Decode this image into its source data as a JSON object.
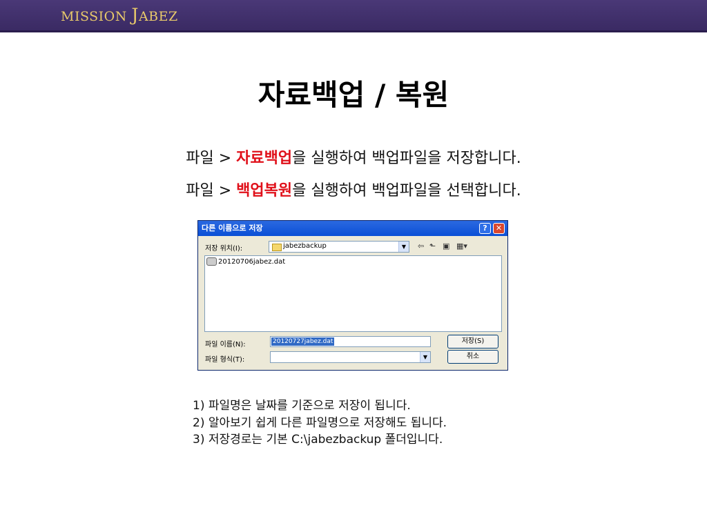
{
  "header": {
    "brand_small": "MISSION ",
    "brand_big": "J",
    "brand_rest": "ABEZ"
  },
  "title": "자료백업 / 복원",
  "instructions": [
    {
      "prefix": "파일 > ",
      "highlight": "자료백업",
      "suffix": "을 실행하여 백업파일을 저장합니다."
    },
    {
      "prefix": "파일 > ",
      "highlight": "백업복원",
      "suffix": "을 실행하여 백업파일을 선택합니다."
    }
  ],
  "dialog": {
    "title": "다른 이름으로 저장",
    "help_label": "?",
    "close_label": "✕",
    "save_in_label": "저장 위치(I):",
    "save_in_value": "jabezbackup",
    "files": [
      {
        "name": "20120706jabez.dat"
      }
    ],
    "filename_label": "파일 이름(N):",
    "filename_value": "20120727jabez.dat",
    "filetype_label": "파일 형식(T):",
    "filetype_value": "",
    "save_button": "저장(S)",
    "cancel_button": "취소",
    "icons": [
      "back-icon",
      "up-folder-icon",
      "new-folder-icon",
      "view-menu-icon"
    ]
  },
  "notes": [
    "1) 파일명은 날짜를 기준으로 저장이 됩니다.",
    "2) 알아보기 쉽게 다른 파일명으로 저장해도 됩니다.",
    "3) 저장경로는 기본 C:\\jabezbackup 폴더입니다."
  ],
  "colors": {
    "header_bg": "#3a2a63",
    "brand": "#e8c96a",
    "highlight": "#e0101a"
  }
}
